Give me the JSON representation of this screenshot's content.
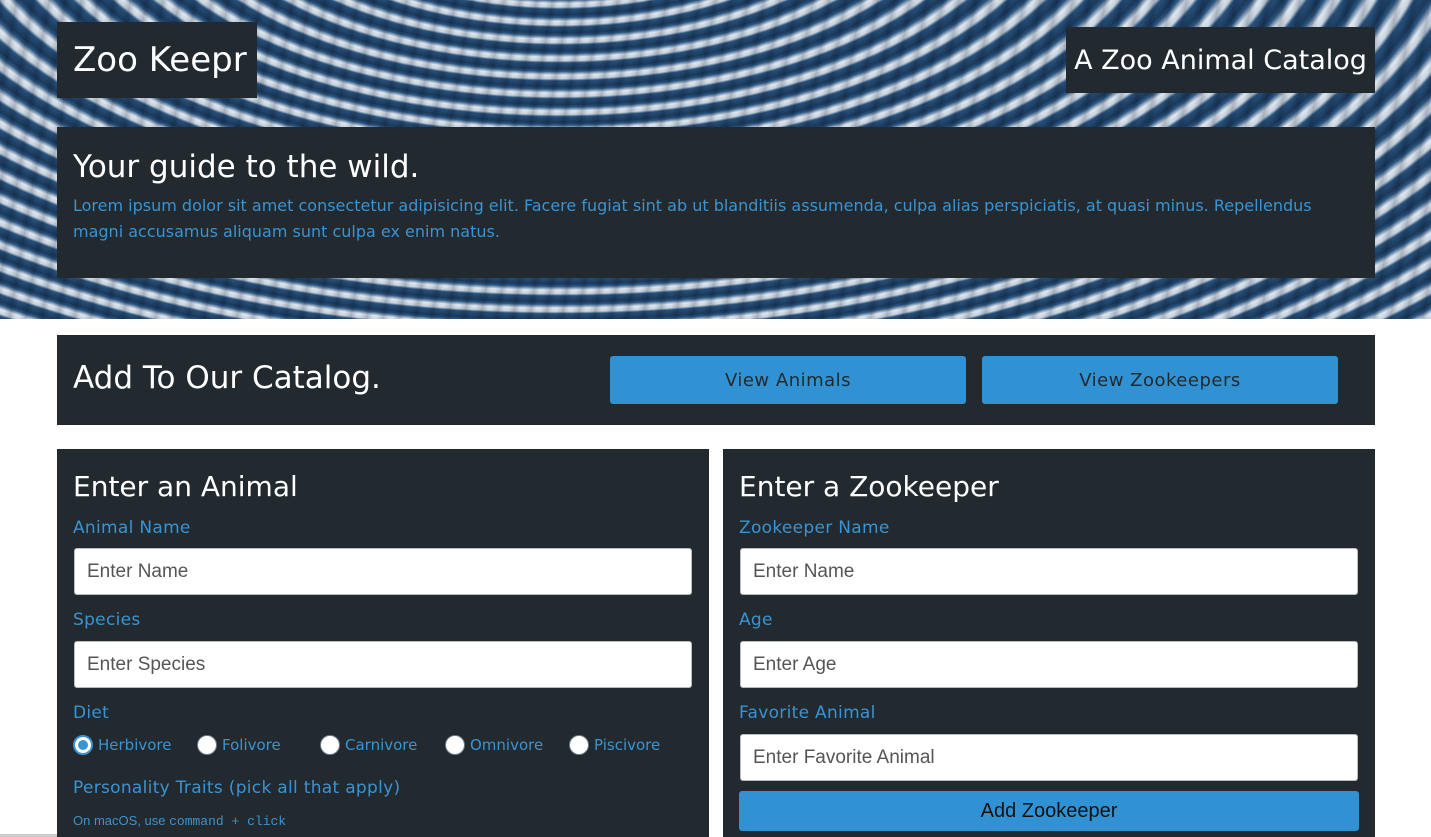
{
  "header": {
    "brand": "Zoo Keepr",
    "tagline": "A Zoo Animal Catalog"
  },
  "hero": {
    "heading": "Your guide to the wild.",
    "text": "Lorem ipsum dolor sit amet consectetur adipisicing elit. Facere fugiat sint ab ut blanditiis assumenda, culpa alias perspiciatis, at quasi minus. Repellendus magni accusamus aliquam sunt culpa ex enim natus."
  },
  "catalog": {
    "heading": "Add To Our Catalog.",
    "view_animals": "View Animals",
    "view_zookeepers": "View Zookeepers"
  },
  "animal_form": {
    "heading": "Enter an Animal",
    "name_label": "Animal Name",
    "name_placeholder": "Enter Name",
    "species_label": "Species",
    "species_placeholder": "Enter Species",
    "diet_label": "Diet",
    "diet_options": [
      {
        "label": "Herbivore",
        "checked": true
      },
      {
        "label": "Folivore",
        "checked": false
      },
      {
        "label": "Carnivore",
        "checked": false
      },
      {
        "label": "Omnivore",
        "checked": false
      },
      {
        "label": "Piscivore",
        "checked": false
      }
    ],
    "traits_label": "Personality Traits (pick all that apply)",
    "hint_prefix": "On macOS, use ",
    "hint_code": "command + click"
  },
  "keeper_form": {
    "heading": "Enter a Zookeeper",
    "name_label": "Zookeeper Name",
    "name_placeholder": "Enter Name",
    "age_label": "Age",
    "age_placeholder": "Enter Age",
    "favorite_label": "Favorite Animal",
    "favorite_placeholder": "Enter Favorite Animal",
    "submit": "Add Zookeeper"
  },
  "colors": {
    "panel": "#222a2f",
    "accent": "#3192d3",
    "label_text": "#3a93d2"
  }
}
